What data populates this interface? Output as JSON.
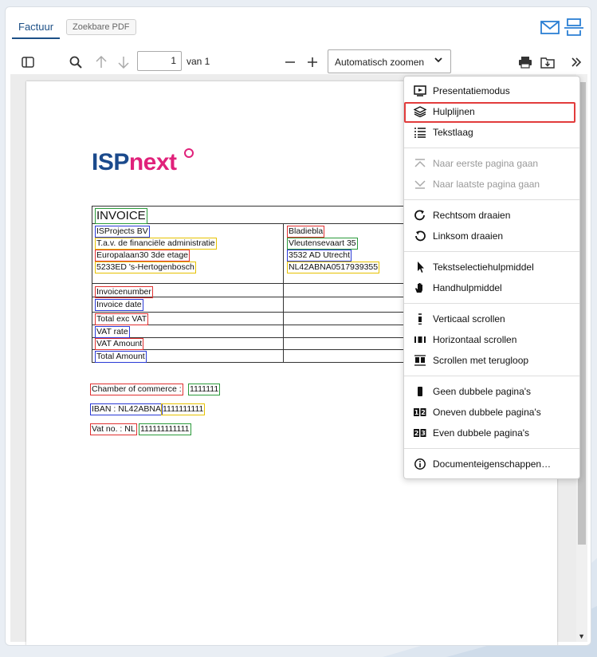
{
  "tabs": {
    "active": "Factuur",
    "other": "Zoekbare PDF"
  },
  "toolbar": {
    "page": "1",
    "page_count": "van 1",
    "zoom": "Automatisch zoomen"
  },
  "document": {
    "logo_isp": "ISP",
    "logo_next": "next",
    "invoice_title": "INVOICE",
    "sender": [
      "ISProjects BV",
      "T.a.v. de financiële administratie",
      "Europalaan30 3de etage",
      "5233ED 's-Hertogenbosch"
    ],
    "recipient": [
      "Bladiebla",
      "Vleutensevaart 35",
      "3532 AD Utrecht",
      "NL42ABNA0517939355"
    ],
    "fields": [
      "Invoicenumber",
      "Invoice date",
      "Total exc VAT",
      "VAT rate",
      "VAT Amount",
      "Total Amount"
    ],
    "coc_label": "Chamber of commerce :",
    "coc_value": "1111111",
    "iban_label": "IBAN : NL42ABNA",
    "iban_value": "1111111111",
    "vat_label": "Vat no. : NL",
    "vat_value": "111111111111"
  },
  "menu": {
    "items": [
      {
        "label": "Presentatiemodus",
        "icon": "presentation-icon",
        "enabled": true
      },
      {
        "label": "Hulplijnen",
        "icon": "layers-icon",
        "enabled": true
      },
      {
        "label": "Tekstlaag",
        "icon": "text-layer-icon",
        "enabled": true
      },
      {
        "label": "Naar eerste pagina gaan",
        "icon": "first-page-icon",
        "enabled": false
      },
      {
        "label": "Naar laatste pagina gaan",
        "icon": "last-page-icon",
        "enabled": false
      },
      {
        "label": "Rechtsom draaien",
        "icon": "rotate-cw-icon",
        "enabled": true
      },
      {
        "label": "Linksom draaien",
        "icon": "rotate-ccw-icon",
        "enabled": true
      },
      {
        "label": "Tekstselectiehulpmiddel",
        "icon": "cursor-icon",
        "enabled": true
      },
      {
        "label": "Handhulpmiddel",
        "icon": "hand-icon",
        "enabled": true
      },
      {
        "label": "Verticaal scrollen",
        "icon": "vertical-scroll-icon",
        "enabled": true
      },
      {
        "label": "Horizontaal scrollen",
        "icon": "horizontal-scroll-icon",
        "enabled": true
      },
      {
        "label": "Scrollen met terugloop",
        "icon": "wrapped-scroll-icon",
        "enabled": true
      },
      {
        "label": "Geen dubbele pagina's",
        "icon": "single-page-icon",
        "enabled": true
      },
      {
        "label": "Oneven dubbele pagina's",
        "icon": "odd-spread-icon",
        "enabled": true
      },
      {
        "label": "Even dubbele pagina's",
        "icon": "even-spread-icon",
        "enabled": true
      },
      {
        "label": "Documenteigenschappen…",
        "icon": "info-icon",
        "enabled": true
      }
    ],
    "highlighted": "Hulplijnen"
  },
  "colors": {
    "accent": "#1c4f86",
    "brand_blue": "#1b4a8c",
    "brand_pink": "#e0217a",
    "highlight": "#e23c3c"
  }
}
